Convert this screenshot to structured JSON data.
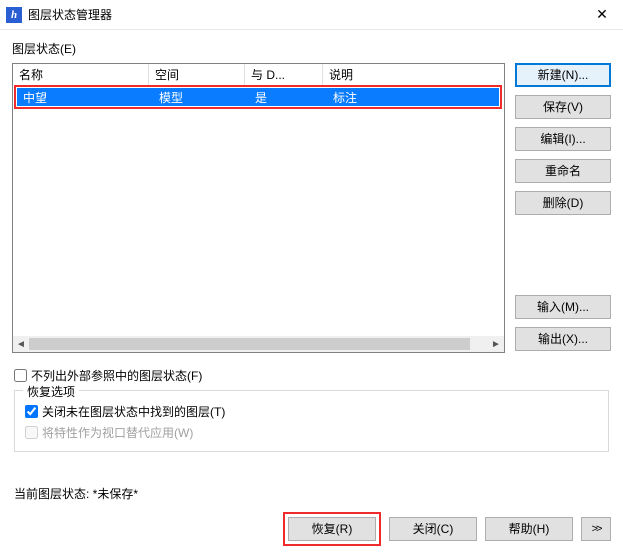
{
  "titlebar": {
    "icon_text": "h",
    "title": "图层状态管理器"
  },
  "section_label": "图层状态(E)",
  "table": {
    "headers": {
      "name": "名称",
      "space": "空间",
      "dd": "与 D...",
      "desc": "说明"
    },
    "rows": [
      {
        "name": "中望",
        "space": "模型",
        "dd": "是",
        "desc": "标注"
      }
    ]
  },
  "buttons": {
    "new": "新建(N)...",
    "save": "保存(V)",
    "edit": "编辑(I)...",
    "rename": "重命名",
    "delete": "删除(D)",
    "import": "输入(M)...",
    "export": "输出(X)...",
    "restore": "恢复(R)",
    "close": "关闭(C)",
    "help": "帮助(H)"
  },
  "checkbox1": {
    "label": "不列出外部参照中的图层状态(F)"
  },
  "fieldset": {
    "legend": "恢复选项",
    "opt1": "关闭未在图层状态中找到的图层(T)",
    "opt2": "将特性作为视口替代应用(W)"
  },
  "status": {
    "prefix": "当前图层状态: ",
    "value": "*未保存*"
  },
  "expand_glyph": ">>"
}
